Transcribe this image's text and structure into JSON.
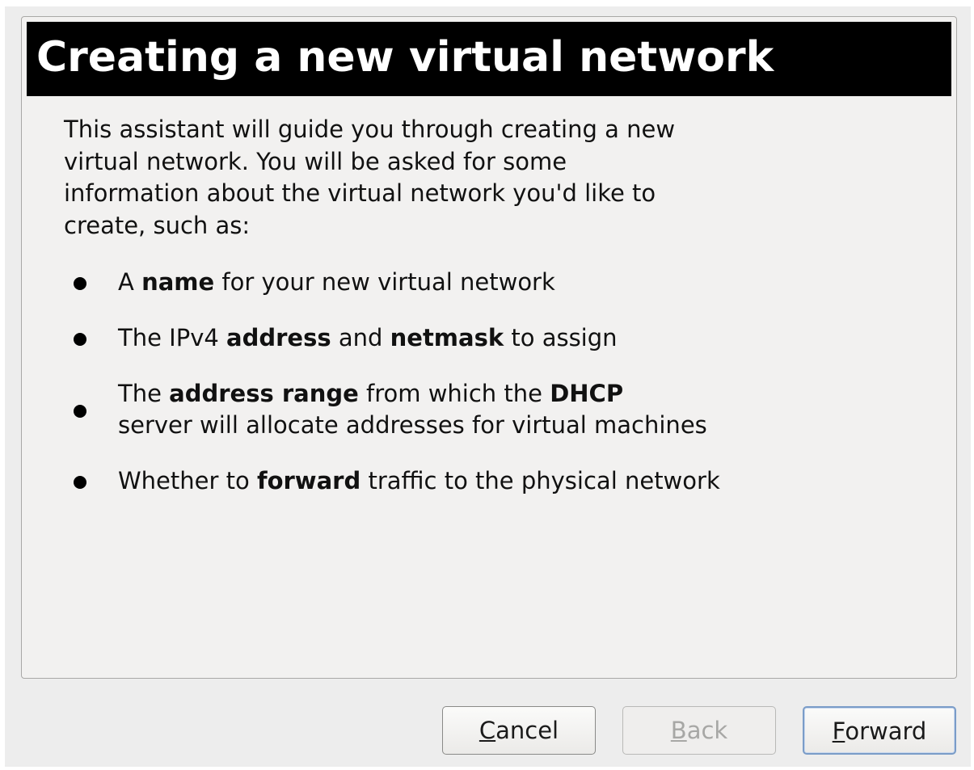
{
  "header": {
    "title": "Creating a new virtual network"
  },
  "intro": {
    "lines": [
      "This assistant will guide you through creating a new",
      "virtual network. You will be asked for some",
      "information about the virtual network you'd like to",
      "create, such as:"
    ]
  },
  "bullets": [
    {
      "segments": [
        "A ",
        "name",
        " for your new virtual network"
      ]
    },
    {
      "segments": [
        "The IPv4 ",
        "address",
        " and ",
        "netmask",
        " to assign"
      ]
    },
    {
      "segments": [
        "The ",
        "address range",
        " from which the ",
        "DHCP"
      ],
      "segments2": [
        "server will allocate addresses for virtual machines"
      ]
    },
    {
      "segments": [
        "Whether to ",
        "forward",
        " traffic to the physical network"
      ]
    }
  ],
  "buttons": {
    "cancel": {
      "mnemonic": "C",
      "rest": "ancel",
      "enabled": true
    },
    "back": {
      "mnemonic": "B",
      "rest": "ack",
      "enabled": false
    },
    "forward": {
      "mnemonic": "F",
      "rest": "orward",
      "enabled": true,
      "default": true
    }
  },
  "colors": {
    "banner_bg": "#000000",
    "banner_text": "#ffffff",
    "panel_bg": "#f2f1f0",
    "default_button_border": "#7a9cc8"
  },
  "icons": [
    "bullet-dot"
  ]
}
